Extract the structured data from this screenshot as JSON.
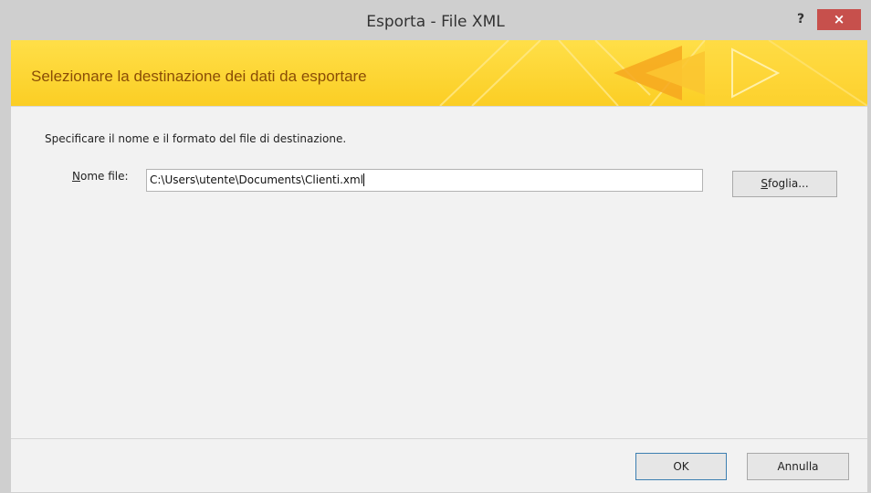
{
  "window": {
    "title": "Esporta - File XML",
    "help_label": "?",
    "close_label": "×"
  },
  "banner": {
    "heading": "Selezionare la destinazione dei dati da esportare"
  },
  "form": {
    "instruction": "Specificare il nome e il formato del file di destinazione.",
    "file_label_key": "N",
    "file_label_rest": "ome file:",
    "file_value": "C:\\Users\\utente\\Documents\\Clienti.xml",
    "browse_key": "S",
    "browse_rest": "foglia..."
  },
  "footer": {
    "ok_label": "OK",
    "cancel_label": "Annulla"
  },
  "colors": {
    "banner": "#fbd230",
    "banner_text": "#8a4d06",
    "close_button": "#c7504c",
    "frame": "#cfcfcf",
    "client": "#f2f2f2"
  }
}
